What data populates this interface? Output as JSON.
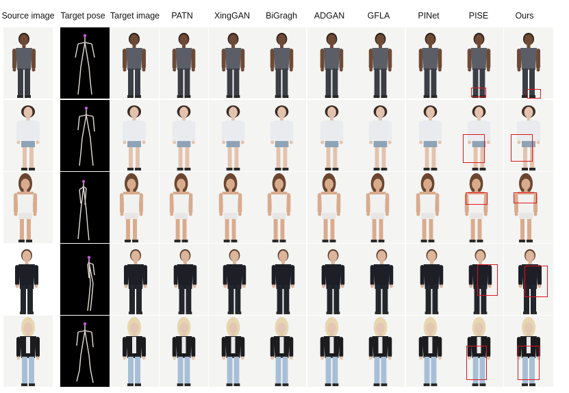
{
  "figure": {
    "columns": [
      {
        "label": "Source image",
        "kind": "photo"
      },
      {
        "label": "Target pose",
        "kind": "pose"
      },
      {
        "label": "Target image",
        "kind": "photo"
      },
      {
        "label": "PATN",
        "kind": "photo"
      },
      {
        "label": "XingGAN",
        "kind": "photo"
      },
      {
        "label": "BiGragh",
        "kind": "photo"
      },
      {
        "label": "ADGAN",
        "kind": "photo"
      },
      {
        "label": "GFLA",
        "kind": "photo"
      },
      {
        "label": "PINet",
        "kind": "photo"
      },
      {
        "label": "PISE",
        "kind": "photo"
      },
      {
        "label": "Ours",
        "kind": "photo"
      }
    ],
    "rows": [
      {
        "subject": "tank-top-man",
        "top": "#5b5e66",
        "bottom": "#3b3e45",
        "skin": "#6e4a36",
        "hair": "#2a1d16",
        "highlight_columns": [
          "PISE",
          "Ours"
        ]
      },
      {
        "subject": "white-blouse-woman",
        "top": "#e9ebee",
        "bottom": "#8ea3b5",
        "skin": "#e3c3ae",
        "hair": "#3a2a22",
        "highlight_columns": [
          "PISE",
          "Ours"
        ]
      },
      {
        "subject": "offshoulder-woman",
        "top": "#f1f1f0",
        "bottom": "#e8e6e4",
        "skin": "#d9ab8d",
        "hair": "#6a4630",
        "highlight_columns": [
          "PISE",
          "Ours"
        ]
      },
      {
        "subject": "lace-top-woman",
        "top": "#1e1f26",
        "bottom": "#23252c",
        "skin": "#dcb59b",
        "hair": "#5a3c2a",
        "highlight_columns": [
          "PISE",
          "Ours"
        ]
      },
      {
        "subject": "blazer-jeans-woman",
        "top": "#1c1c1f",
        "bottom": "#a7bfd6",
        "skin": "#e4c7b2",
        "hair": "#e6d7b0",
        "highlight_columns": [
          "PISE",
          "Ours"
        ]
      }
    ],
    "accent": "#e0141e"
  }
}
